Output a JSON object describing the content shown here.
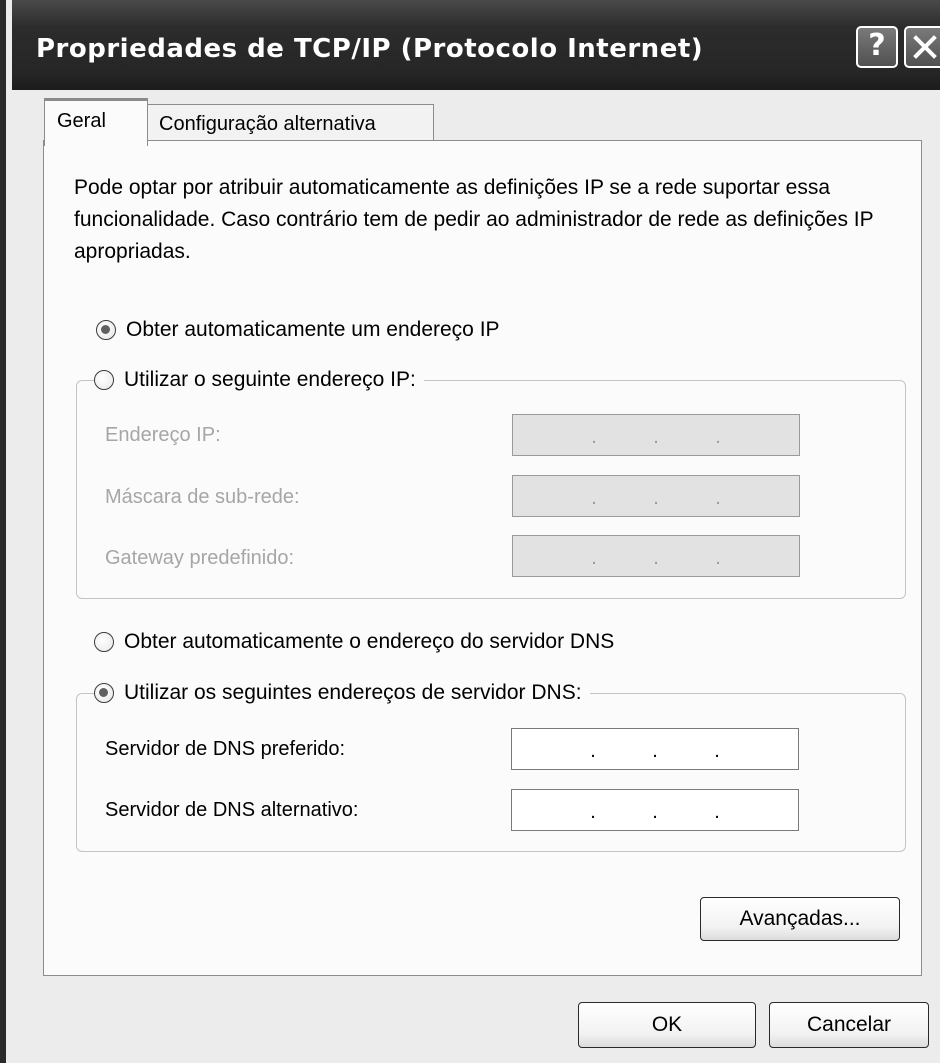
{
  "window": {
    "title": "Propriedades de TCP/IP (Protocolo Internet)",
    "help_glyph": "?",
    "close_icon": "close-icon"
  },
  "tabs": [
    {
      "label": "Geral",
      "selected": true
    },
    {
      "label": "Configuração alternativa",
      "selected": false
    }
  ],
  "description": "Pode optar por atribuir automaticamente as definições IP se a rede suportar essa funcionalidade. Caso contrário tem de pedir ao administrador de rede as definições IP apropriadas.",
  "ip_options": {
    "auto_label": "Obter automaticamente um endereço IP",
    "auto_checked": true,
    "manual_label": "Utilizar o seguinte endereço IP:",
    "manual_checked": false
  },
  "ip_fields": [
    {
      "label": "Endereço IP:",
      "value": "",
      "enabled": false
    },
    {
      "label": "Máscara de sub-rede:",
      "value": "",
      "enabled": false
    },
    {
      "label": "Gateway predefinido:",
      "value": "",
      "enabled": false
    }
  ],
  "dns_options": {
    "auto_label": "Obter automaticamente o endereço do servidor DNS",
    "auto_checked": false,
    "manual_label": "Utilizar os seguintes endereços de servidor DNS:",
    "manual_checked": true
  },
  "dns_fields": [
    {
      "label": "Servidor de DNS preferido:",
      "value": "",
      "enabled": true
    },
    {
      "label": "Servidor de DNS alternativo:",
      "value": "",
      "enabled": true
    }
  ],
  "ip_dot": ".",
  "buttons": {
    "advanced": "Avançadas...",
    "ok": "OK",
    "cancel": "Cancelar"
  }
}
